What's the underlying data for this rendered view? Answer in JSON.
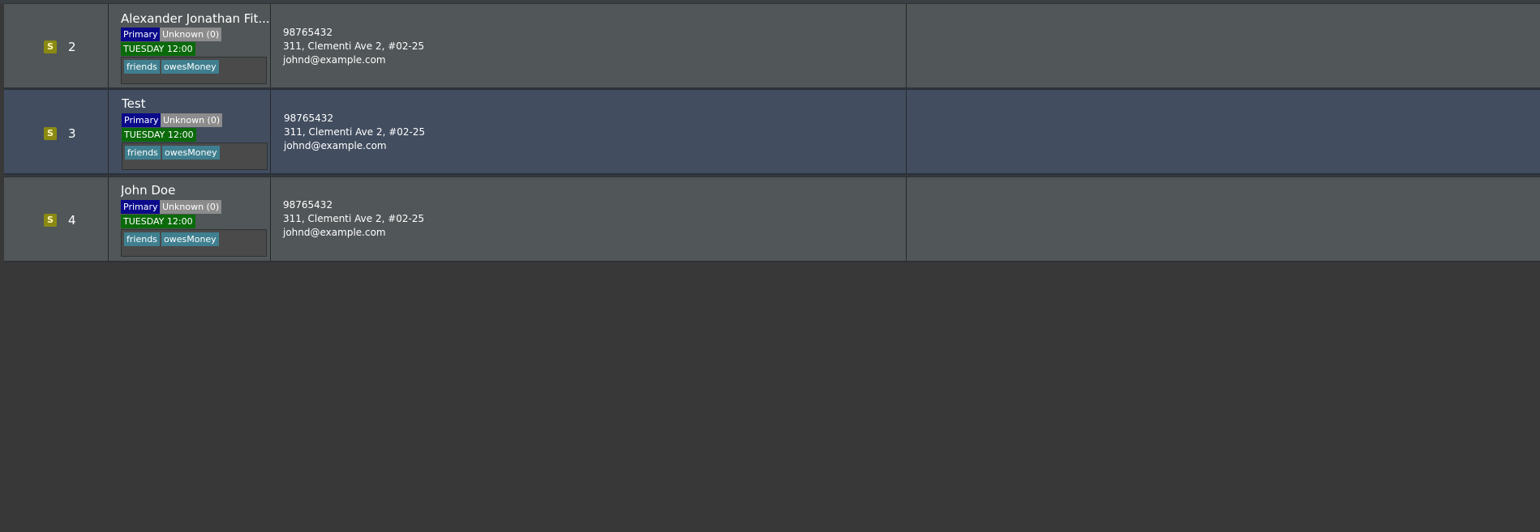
{
  "persons": [
    {
      "index": "2",
      "status_badge": "S",
      "name": "Alexander Jonathan Fit...",
      "role_label": "Primary",
      "unknown_label": "Unknown (0)",
      "schedule": "TUESDAY 12:00",
      "tags": [
        "friends",
        "owesMoney"
      ],
      "phone": "98765432",
      "address": "311, Clementi Ave 2, #02-25",
      "email": "johnd@example.com",
      "selected": false
    },
    {
      "index": "3",
      "status_badge": "S",
      "name": "Test",
      "role_label": "Primary",
      "unknown_label": "Unknown (0)",
      "schedule": "TUESDAY 12:00",
      "tags": [
        "friends",
        "owesMoney"
      ],
      "phone": "98765432",
      "address": "311, Clementi Ave 2, #02-25",
      "email": "johnd@example.com",
      "selected": true
    },
    {
      "index": "4",
      "status_badge": "S",
      "name": "John Doe",
      "role_label": "Primary",
      "unknown_label": "Unknown (0)",
      "schedule": "TUESDAY 12:00",
      "tags": [
        "friends",
        "owesMoney"
      ],
      "phone": "98765432",
      "address": "311, Clementi Ave 2, #02-25",
      "email": "johnd@example.com",
      "selected": false
    }
  ],
  "colors": {
    "background": "#383838",
    "row": "#515658",
    "row_selected": "#424d5f",
    "primary_tag": "#0a0a8a",
    "unknown_tag": "#8c8c8c",
    "schedule_tag": "#0a6a0a",
    "label_tag": "#3f7f8f",
    "status_badge": "#8a8a13"
  }
}
